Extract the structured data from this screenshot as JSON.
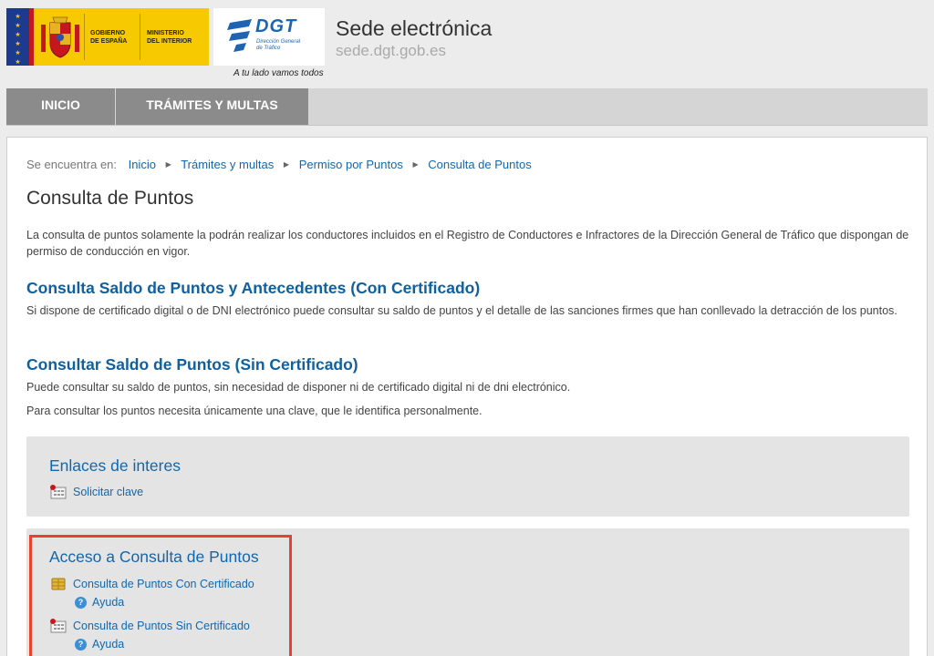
{
  "header": {
    "gov_logo_text_1": [
      "GOBIERNO",
      "DE ESPAÑA"
    ],
    "gov_logo_text_2": [
      "MINISTERIO",
      "DEL INTERIOR"
    ],
    "dgt_name": "DGT",
    "dgt_subtitle": [
      "Dirección General",
      "de Tráfico"
    ],
    "tagline": "A tu lado vamos todos",
    "site_title": "Sede electrónica",
    "site_url": "sede.dgt.gob.es"
  },
  "nav": {
    "items": [
      {
        "label": "INICIO"
      },
      {
        "label": "TRÁMITES Y MULTAS"
      }
    ]
  },
  "breadcrumb": {
    "label": "Se encuentra en:",
    "items": [
      "Inicio",
      "Trámites y multas",
      "Permiso por Puntos",
      "Consulta de Puntos"
    ]
  },
  "main": {
    "title": "Consulta de Puntos",
    "intro": "La consulta de puntos solamente la podrán realizar los conductores incluidos en el Registro de Conductores e Infractores de la Dirección General de Tráfico que dispongan de permiso de conducción en vigor.",
    "section1": {
      "title": "Consulta Saldo de Puntos y Antecedentes (Con Certificado)",
      "text": "Si dispone de certificado digital o de DNI electrónico puede consultar su saldo de puntos y el detalle de las sanciones firmes que han conllevado la detracción de los puntos."
    },
    "section2": {
      "title": "Consultar Saldo de Puntos (Sin Certificado)",
      "text1": "Puede consultar su saldo de puntos, sin necesidad de disponer ni de certificado digital ni de dni electrónico.",
      "text2": "Para consultar los puntos necesita únicamente una clave, que le identifica personalmente."
    }
  },
  "links_box": {
    "title": "Enlaces de interes",
    "link": "Solicitar clave"
  },
  "access_box": {
    "title": "Acceso a Consulta de Puntos",
    "link1": "Consulta de Puntos Con Certificado",
    "help1": "Ayuda",
    "link2": "Consulta de Puntos Sin Certificado",
    "help2": "Ayuda"
  },
  "colors": {
    "link_blue": "#1167ae",
    "nav_active": "#8b8b8b",
    "highlight_red": "#e8432a",
    "gov_yellow": "#f7c900"
  }
}
